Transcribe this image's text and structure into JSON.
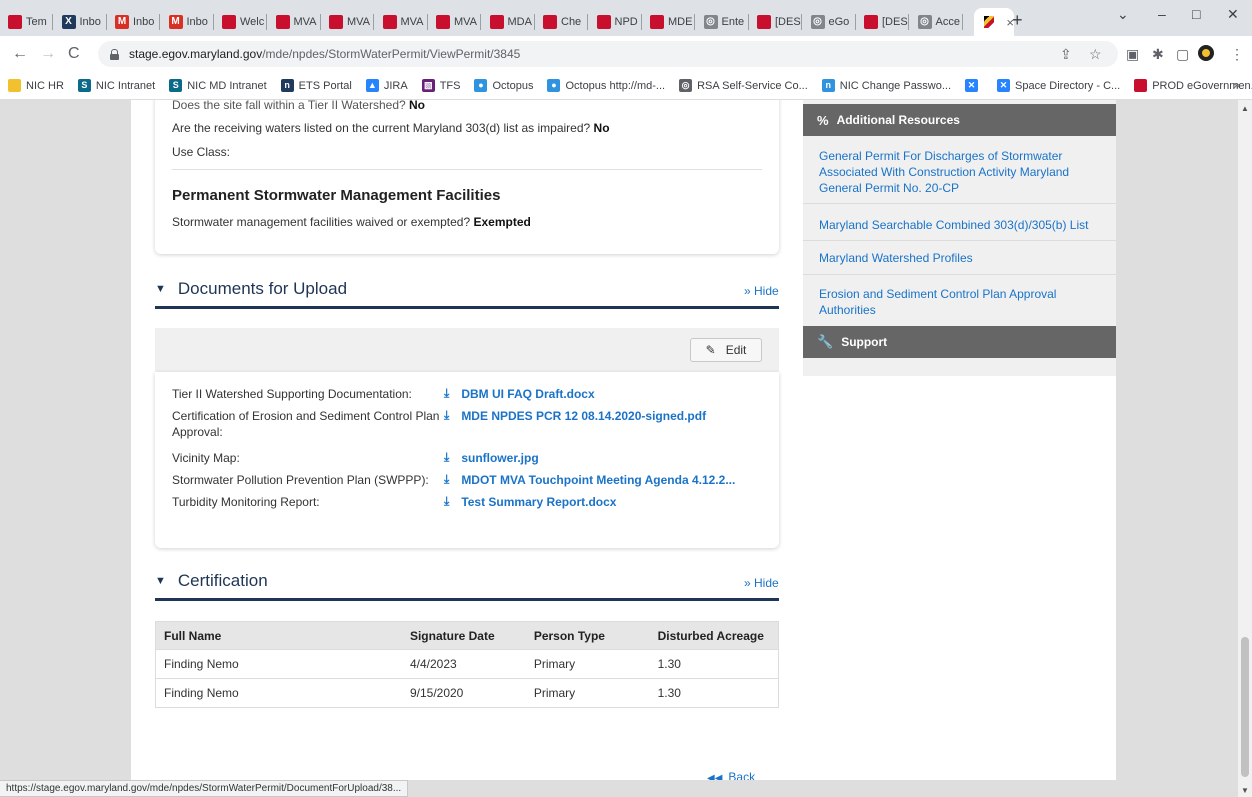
{
  "browser": {
    "tabs": [
      {
        "label": "Tem",
        "icon": "mde-icon",
        "color": "#c8102e"
      },
      {
        "label": "Inbo",
        "icon": "exchange-icon",
        "color": "#1f3a5c"
      },
      {
        "label": "Inbo",
        "icon": "gmail-icon",
        "color": "#d93025"
      },
      {
        "label": "Inbo",
        "icon": "gmail-icon",
        "color": "#d93025"
      },
      {
        "label": "Welc",
        "icon": "mde-icon",
        "color": "#c8102e"
      },
      {
        "label": "MVA",
        "icon": "mde-icon",
        "color": "#c8102e"
      },
      {
        "label": "MVA",
        "icon": "mde-icon",
        "color": "#c8102e"
      },
      {
        "label": "MVA",
        "icon": "mde-icon",
        "color": "#c8102e"
      },
      {
        "label": "MVA",
        "icon": "mde-icon",
        "color": "#c8102e"
      },
      {
        "label": "MDA",
        "icon": "mde-icon",
        "color": "#c8102e"
      },
      {
        "label": "Che",
        "icon": "mde-icon",
        "color": "#c8102e"
      },
      {
        "label": "NPD",
        "icon": "mde-icon",
        "color": "#c8102e"
      },
      {
        "label": "MDE",
        "icon": "mde-icon",
        "color": "#c8102e"
      },
      {
        "label": "Ente",
        "icon": "globe-icon",
        "color": "#80868b"
      },
      {
        "label": "[DES",
        "icon": "mde-icon",
        "color": "#c8102e"
      },
      {
        "label": "eGo",
        "icon": "globe-icon",
        "color": "#80868b"
      },
      {
        "label": "[DES",
        "icon": "mde-icon",
        "color": "#c8102e"
      },
      {
        "label": "Acce",
        "icon": "globe-icon",
        "color": "#80868b"
      }
    ],
    "active_tab": {
      "icon": "maryland-flag-icon",
      "close": "×"
    },
    "new_tab": "+",
    "window_controls": {
      "minimize": "–",
      "maximize": "□",
      "close": "✕",
      "dropdown": "⌄"
    },
    "url_host": "stage.egov.maryland.gov",
    "url_path": "/mde/npdes/StormWaterPermit/ViewPermit/3845",
    "bookmarks": [
      {
        "label": "NIC HR",
        "icon": "folder-icon",
        "color": "#f2c12e"
      },
      {
        "label": "NIC Intranet",
        "icon": "sharepoint-icon",
        "color": "#0b6a8a"
      },
      {
        "label": "NIC MD Intranet",
        "icon": "sharepoint-icon",
        "color": "#0b6a8a"
      },
      {
        "label": "ETS Portal",
        "icon": "nic-icon",
        "color": "#1f3a5c"
      },
      {
        "label": "JIRA",
        "icon": "jira-icon",
        "color": "#2684ff"
      },
      {
        "label": "TFS",
        "icon": "vs-icon",
        "color": "#68217a"
      },
      {
        "label": "Octopus",
        "icon": "octopus-icon",
        "color": "#2f93e0"
      },
      {
        "label": "Octopus http://md-...",
        "icon": "octopus-icon",
        "color": "#2f93e0"
      },
      {
        "label": "RSA Self-Service Co...",
        "icon": "globe-icon",
        "color": "#5f6368"
      },
      {
        "label": "NIC Change Passwo...",
        "icon": "nic-icon",
        "color": "#2f93e0"
      },
      {
        "label": "",
        "icon": "confluence-icon",
        "color": "#2684ff"
      },
      {
        "label": "Space Directory - C...",
        "icon": "confluence-icon",
        "color": "#2684ff"
      },
      {
        "label": "PROD eGovernmen...",
        "icon": "maryland-flag-icon",
        "color": "#c8102e"
      }
    ],
    "bookmarks_more": "»",
    "status_url": "https://stage.egov.maryland.gov/mde/npdes/StormWaterPermit/DocumentForUpload/38..."
  },
  "site_info": {
    "cut_line": "Does the site fall within a Tier II Watershed?",
    "cut_value": "No",
    "impaired_q": "Are the receiving waters listed on the current Maryland 303(d) list as impaired?",
    "impaired_a": "No",
    "use_class": "Use Class:",
    "facilities_heading": "Permanent Stormwater Management Facilities",
    "waived_q": "Stormwater management facilities waived or exempted?",
    "waived_a": "Exempted"
  },
  "documents": {
    "title": "Documents for Upload",
    "hide": "» Hide",
    "edit": "Edit",
    "items": [
      {
        "label": "Tier II Watershed Supporting Documentation:",
        "file": "DBM UI FAQ Draft.docx"
      },
      {
        "label": "Certification of Erosion and Sediment Control Plan Approval:",
        "file": "MDE NPDES PCR 12 08.14.2020-signed.pdf"
      },
      {
        "label": "Vicinity Map:",
        "file": "sunflower.jpg"
      },
      {
        "label": "Stormwater Pollution Prevention Plan (SWPPP):",
        "file": "MDOT MVA Touchpoint Meeting Agenda 4.12.2..."
      },
      {
        "label": "Turbidity Monitoring Report:",
        "file": "Test Summary Report.docx"
      }
    ]
  },
  "certification": {
    "title": "Certification",
    "hide": "» Hide",
    "columns": [
      "Full Name",
      "Signature Date",
      "Person Type",
      "Disturbed Acreage"
    ],
    "rows": [
      [
        "Finding Nemo",
        "4/4/2023",
        "Primary",
        "1.30"
      ],
      [
        "Finding Nemo",
        "9/15/2020",
        "Primary",
        "1.30"
      ]
    ]
  },
  "back": "Back",
  "sidebar": {
    "resources_title": "Additional Resources",
    "links": [
      "General Permit For Discharges of Stormwater Associated With Construction Activity Maryland General Permit No. 20-CP",
      "Maryland Searchable Combined 303(d)/305(b) List",
      "Maryland Watershed Profiles",
      "Erosion and Sediment Control Plan Approval Authorities"
    ],
    "support_title": "Support"
  },
  "colors": {
    "accent": "#1f3555",
    "link": "#1a73c8",
    "sidebar_head": "#666666"
  }
}
